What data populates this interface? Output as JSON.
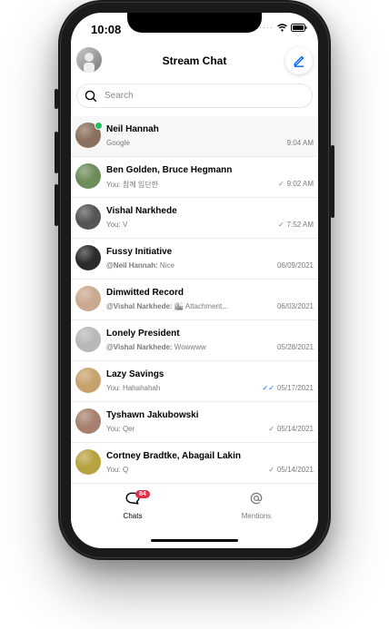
{
  "status": {
    "time": "10:08"
  },
  "header": {
    "title": "Stream Chat"
  },
  "search": {
    "placeholder": "Search"
  },
  "channels": [
    {
      "name": "Neil Hannah",
      "author": "",
      "preview": "Google",
      "time": "9:04 AM",
      "check": "",
      "online": true,
      "avatar_color": "#8a6f5c"
    },
    {
      "name": "Ben Golden, Bruce Hegmann",
      "author": "",
      "preview": "You: 참께 입단한",
      "time": "9:02 AM",
      "check": "✓",
      "online": false,
      "avatar_color": "#6e8c5a"
    },
    {
      "name": "Vishal Narkhede",
      "author": "",
      "preview": "You: V",
      "time": "7:52 AM",
      "check": "✓",
      "online": false,
      "avatar_color": "#555555"
    },
    {
      "name": "Fussy Initiative",
      "author": "@Neil Hannah:",
      "preview": " Nice",
      "time": "06/09/2021",
      "check": "",
      "online": false,
      "avatar_color": "#2b2b2b"
    },
    {
      "name": "Dimwitted Record",
      "author": "@Vishal Narkhede:",
      "preview": " 🏙 Attachment...",
      "time": "06/03/2021",
      "check": "",
      "online": false,
      "avatar_color": "#c9a98f"
    },
    {
      "name": "Lonely President",
      "author": "@Vishal Narkhede:",
      "preview": " Wowwww",
      "time": "05/28/2021",
      "check": "",
      "online": false,
      "avatar_color": "#b8b8b8"
    },
    {
      "name": "Lazy Savings",
      "author": "",
      "preview": "You: Hahahahah",
      "time": "05/17/2021",
      "check": "✓✓",
      "online": false,
      "avatar_color": "#c8a26c"
    },
    {
      "name": "Tyshawn Jakubowski",
      "author": "",
      "preview": "You: Qer",
      "time": "05/14/2021",
      "check": "✓",
      "online": false,
      "avatar_color": "#a88070"
    },
    {
      "name": "Cortney Bradtke, Abagail Lakin",
      "author": "",
      "preview": "You: Q",
      "time": "05/14/2021",
      "check": "✓",
      "online": false,
      "avatar_color": "#b7a240"
    }
  ],
  "tabs": [
    {
      "label": "Chats",
      "badge": "84",
      "active": true
    },
    {
      "label": "Mentions",
      "badge": "",
      "active": false
    }
  ],
  "colors": {
    "accent": "#005fff",
    "online": "#20c05a",
    "badge": "#e0304a"
  }
}
